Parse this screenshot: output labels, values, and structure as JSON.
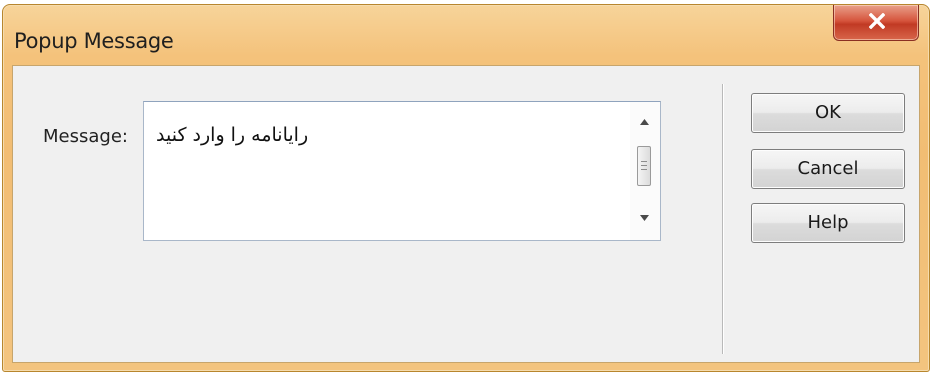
{
  "window": {
    "title": "Popup Message",
    "close_label": "X"
  },
  "form": {
    "message_label": "Message:",
    "message_value": "رایانامه را وارد کنید"
  },
  "buttons": {
    "ok_label": "OK",
    "cancel_label": "Cancel",
    "help_label": "Help"
  },
  "icons": {
    "close": "close-icon",
    "scroll_up": "scroll-up-arrow-icon",
    "scroll_down": "scroll-down-arrow-icon"
  },
  "colors": {
    "title_bar": "#f4c27b",
    "close_button": "#d04a32",
    "dialog_body": "#f0f0f0"
  }
}
